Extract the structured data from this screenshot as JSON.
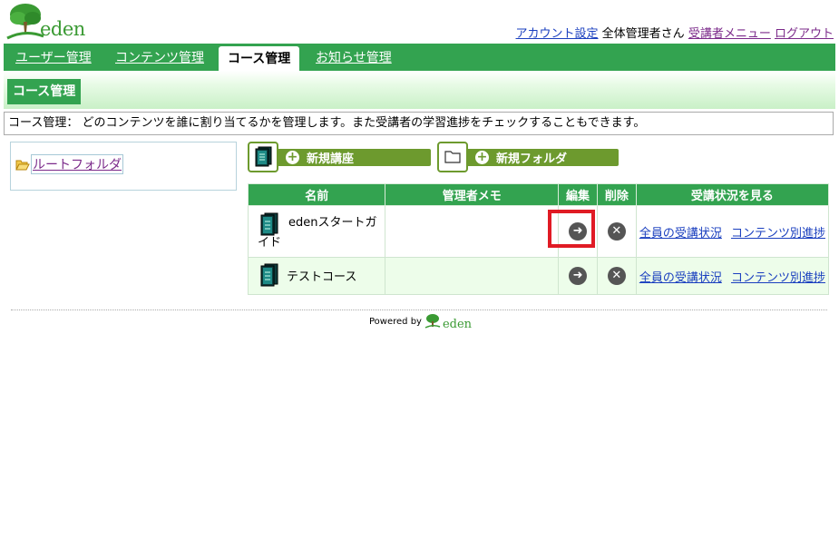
{
  "header": {
    "logo_text": "eden",
    "links": {
      "account": "アカウント設定",
      "user": "全体管理者さん",
      "learner_menu": "受講者メニュー",
      "logout": "ログアウト"
    }
  },
  "nav": {
    "tabs": [
      {
        "label": "ユーザー管理"
      },
      {
        "label": "コンテンツ管理"
      },
      {
        "label": "コース管理"
      },
      {
        "label": "お知らせ管理"
      }
    ]
  },
  "subnav": {
    "label": "コース管理"
  },
  "description": "コース管理： どのコンテンツを誰に割り当てるかを管理します。また受講者の学習進捗をチェックすることもできます。",
  "folders": {
    "root": "ルートフォルダ"
  },
  "actions": {
    "new_course": "新規講座",
    "new_folder": "新規フォルダ"
  },
  "table": {
    "headers": {
      "name": "名前",
      "memo": "管理者メモ",
      "edit": "編集",
      "delete": "削除",
      "status": "受講状況を見る"
    },
    "rows": [
      {
        "name": "edenスタートガイド",
        "memo": "",
        "all_status": "全員の受講状況",
        "content_progress": "コンテンツ別進捗"
      },
      {
        "name": "テストコース",
        "memo": "",
        "all_status": "全員の受講状況",
        "content_progress": "コンテンツ別進捗"
      }
    ]
  },
  "footer": {
    "powered": "Powered by",
    "brand": "eden"
  },
  "colors": {
    "primary_green": "#33a350",
    "action_green": "#6d9a2e",
    "link_blue": "#1a3fbf",
    "link_purple": "#7b2a8a",
    "highlight_red": "#e01b24"
  }
}
